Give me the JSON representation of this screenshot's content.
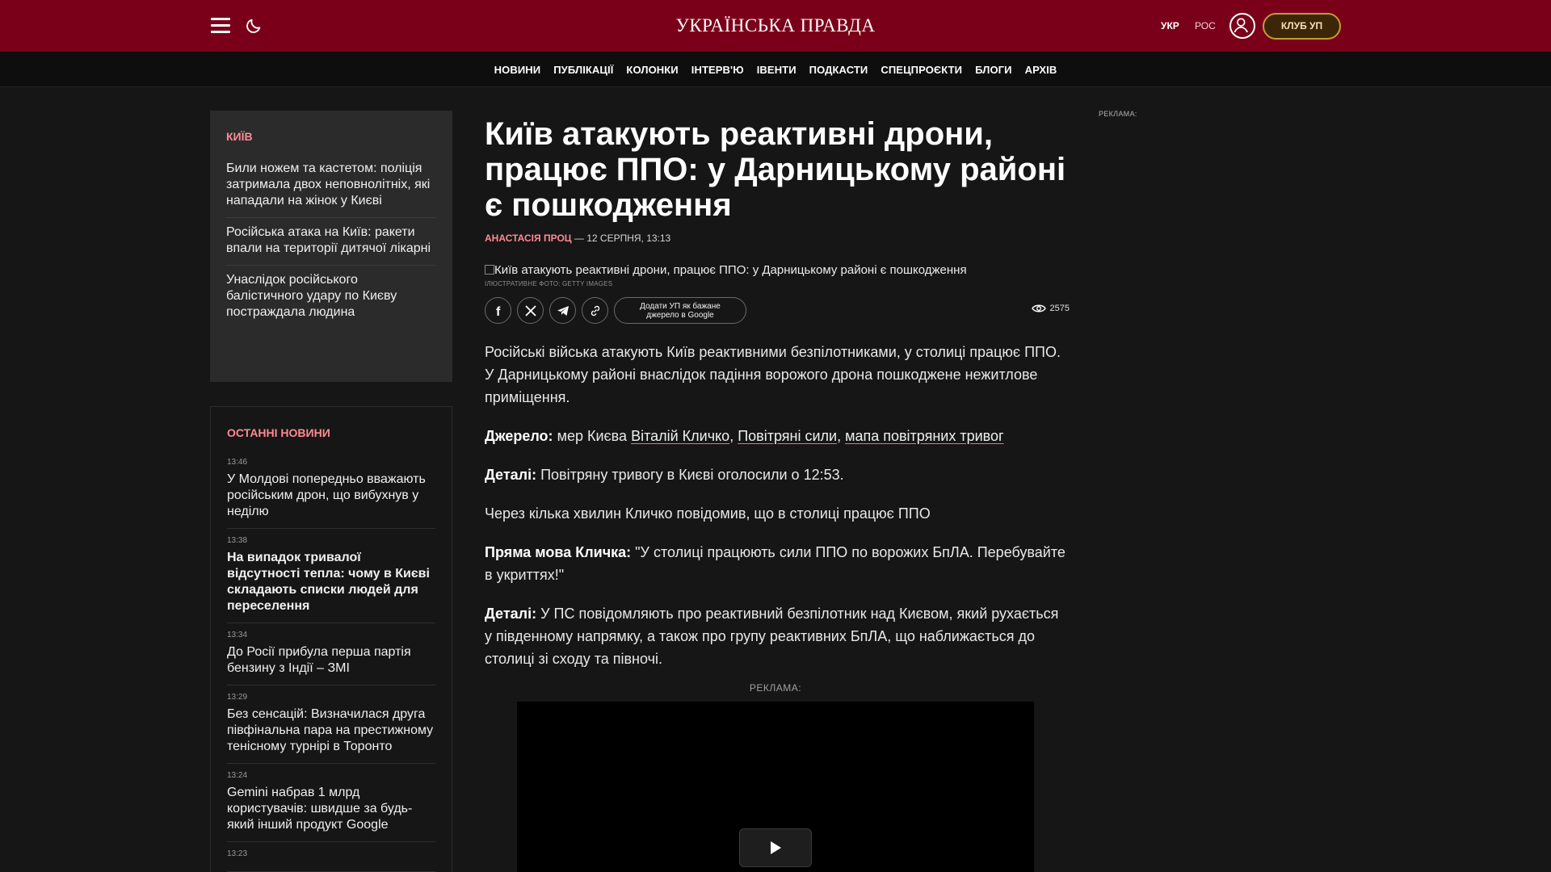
{
  "header": {
    "logo": "УКРАЇНСЬКА ПРАВДА",
    "lang_ukr": "УКР",
    "lang_ros": "РОС",
    "club_button": "КЛУБ УП"
  },
  "nav": [
    "НОВИНИ",
    "ПУБЛІКАЦІЇ",
    "КОЛОНКИ",
    "ІНТЕРВ'Ю",
    "ІВЕНТИ",
    "ПОДКАСТИ",
    "СПЕЦПРОЄКТИ",
    "БЛОГИ",
    "АРХІВ"
  ],
  "kyiv_section": {
    "title": "КИЇВ",
    "items": [
      "Били ножем та кастетом: поліція затримала двох неповнолітніх, які нападали на жінок у Києві",
      "Російська атака на Київ: ракети впали на території дитячої лікарні",
      "Унаслідок російського балістичного удару по Києву постраждала людина"
    ]
  },
  "latest_news": {
    "title": "ОСТАННІ НОВИНИ",
    "items": [
      {
        "time": "13:46",
        "title": "У Молдові попередньо вважають російським дрон, що вибухнув у неділю",
        "bold": false
      },
      {
        "time": "13:38",
        "title": "На випадок тривалої відсутності тепла: чому в Києві складають списки людей для переселення",
        "bold": true
      },
      {
        "time": "13:34",
        "title": "До Росії прибула перша партія бензину з Індії – ЗМІ",
        "bold": false
      },
      {
        "time": "13:29",
        "title": "Без сенсацій: Визначилася друга півфінальна пара на престижному тенісному турнірі в Торонто",
        "bold": false
      },
      {
        "time": "13:24",
        "title": "Gemini набрав 1 млрд користувачів: швидше за будь-який інший продукт Google",
        "bold": false
      },
      {
        "time": "13:23",
        "title": "",
        "bold": false
      }
    ]
  },
  "article": {
    "headline": "Київ атакують реактивні дрони, працює ППО: у Дарницькому районі є пошкодження",
    "author": "АНАСТАСІЯ ПРОЦ",
    "date": " — 12 СЕРПНЯ, 13:13",
    "image_alt": "Київ атакують реактивні дрони, працює ППО: у Дарницькому районі є пошкодження",
    "photo_credit": "ІЛЮСТРАТИВНЕ ФОТО: GETTY IMAGES",
    "google_button_line1": "Додати УП як бажане",
    "google_button_line2": "джерело в Google",
    "views": "2575",
    "lead": "Російські війська атакують Київ реактивними безпілотниками, у столиці працює ППО. У Дарницькому районі внаслідок падіння ворожого дрона пошкоджене нежитлове приміщення.",
    "source_label": "Джерело:",
    "source_text": " мер Києва ",
    "source_link1": "Віталій Кличко",
    "source_link2": "Повітряні сили",
    "source_link3": "мапа повітряних тривог",
    "details1_label": "Деталі:",
    "details1_text": " Повітряну тривогу в Києві оголосили о 12:53.",
    "para3": "Через кілька хвилин Кличко повідомив, що в столиці працює ППО",
    "quote_label": "Пряма мова Кличка:",
    "quote_text": " \"У столиці працюють сили ППО по ворожих БпЛА. Перебувайте в укриттях!\"",
    "details2_label": "Деталі:",
    "details2_text": " У ПС повідомляють про реактивний безпілотник над Києвом, який рухається у південному напрямку, а також про групу реактивних БпЛА, що наближається до столиці зі сходу та півночі."
  },
  "ad_label": "РЕКЛАМА:",
  "right_ad_label": "РЕКЛАМА:"
}
